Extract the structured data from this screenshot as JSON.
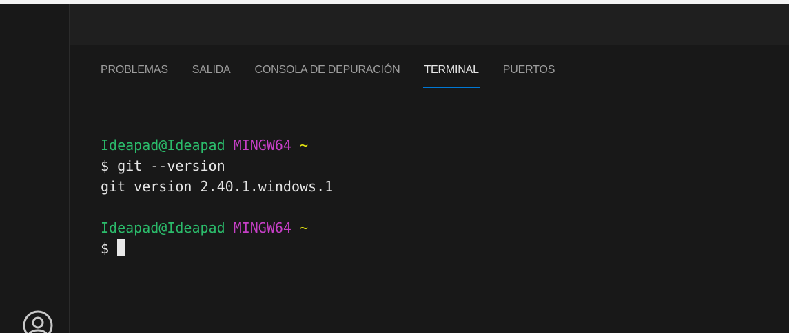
{
  "panel": {
    "tabs": [
      {
        "label": "PROBLEMAS"
      },
      {
        "label": "SALIDA"
      },
      {
        "label": "CONSOLA DE DEPURACIÓN"
      },
      {
        "label": "TERMINAL",
        "active": true
      },
      {
        "label": "PUERTOS"
      }
    ]
  },
  "terminal": {
    "prompt1": {
      "user_host": "Ideapad@Ideapad",
      "env": "MINGW64",
      "path": "~"
    },
    "command_line": "$ git --version",
    "output_line": "git version 2.40.1.windows.1",
    "prompt2": {
      "user_host": "Ideapad@Ideapad",
      "env": "MINGW64",
      "path": "~"
    },
    "input_prefix": "$ "
  },
  "activity_bar": {
    "bottom_icon": "account-icon"
  },
  "colors": {
    "background": "#181818",
    "tab_active_underline": "#0078d4",
    "prompt_user": "#2bbc6b",
    "prompt_env": "#c63fc6",
    "prompt_path": "#e5e510"
  }
}
